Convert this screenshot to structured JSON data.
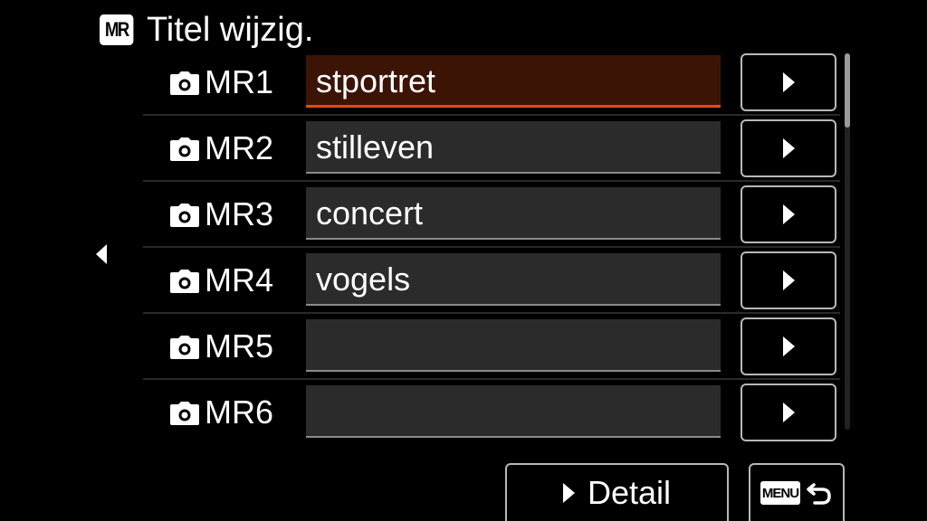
{
  "header": {
    "badge": "MR",
    "title": "Titel wijzig."
  },
  "rows": [
    {
      "label": "MR1",
      "name": "stportret",
      "selected": true
    },
    {
      "label": "MR2",
      "name": "stilleven",
      "selected": false
    },
    {
      "label": "MR3",
      "name": "concert",
      "selected": false
    },
    {
      "label": "MR4",
      "name": "vogels",
      "selected": false
    },
    {
      "label": "MR5",
      "name": "",
      "selected": false
    },
    {
      "label": "MR6",
      "name": "",
      "selected": false
    }
  ],
  "footer": {
    "detail_label": "Detail",
    "menu_badge": "MENU"
  },
  "colors": {
    "selected_fill": "#3c1406",
    "selected_accent": "#e24b16",
    "field_fill": "#2b2b2b"
  },
  "icons": {
    "row_icon": "camera-icon",
    "nav_left": "triangle-left-icon",
    "row_arrow": "triangle-right-icon",
    "back": "return-arrow-icon"
  }
}
